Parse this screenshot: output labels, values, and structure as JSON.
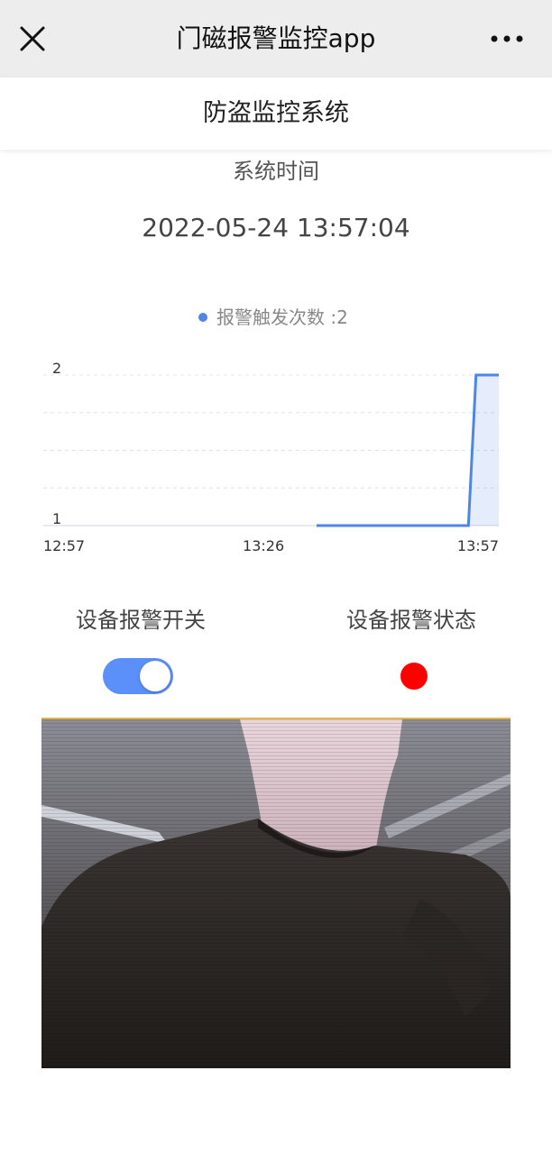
{
  "titlebar": {
    "close_icon": "close-icon",
    "title": "门磁报警监控app",
    "more_icon": "more-icon"
  },
  "header": {
    "title": "防盗监控系统"
  },
  "system_time": {
    "label": "系统时间",
    "value": "2022-05-24 13:57:04"
  },
  "chart_data": {
    "type": "area",
    "title": "",
    "xlabel": "",
    "ylabel": "",
    "legend_position": "top-center",
    "grid": true,
    "x_ticks": [
      "12:57",
      "13:26",
      "13:57"
    ],
    "y_ticks": [
      "1",
      "2"
    ],
    "ylim": [
      1,
      2
    ],
    "series": [
      {
        "name": "报警触发次数 :2",
        "color": "#4e86e8",
        "x": [
          "13:33",
          "13:53",
          "13:54",
          "13:57"
        ],
        "values": [
          1,
          1,
          2,
          2
        ]
      }
    ]
  },
  "controls": {
    "switch_label": "设备报警开关",
    "switch_on": true,
    "switch_color": "#5b8ff9",
    "status_label": "设备报警状态",
    "status_color": "#ff0000"
  },
  "camera": {
    "icon": "camera-feed"
  }
}
